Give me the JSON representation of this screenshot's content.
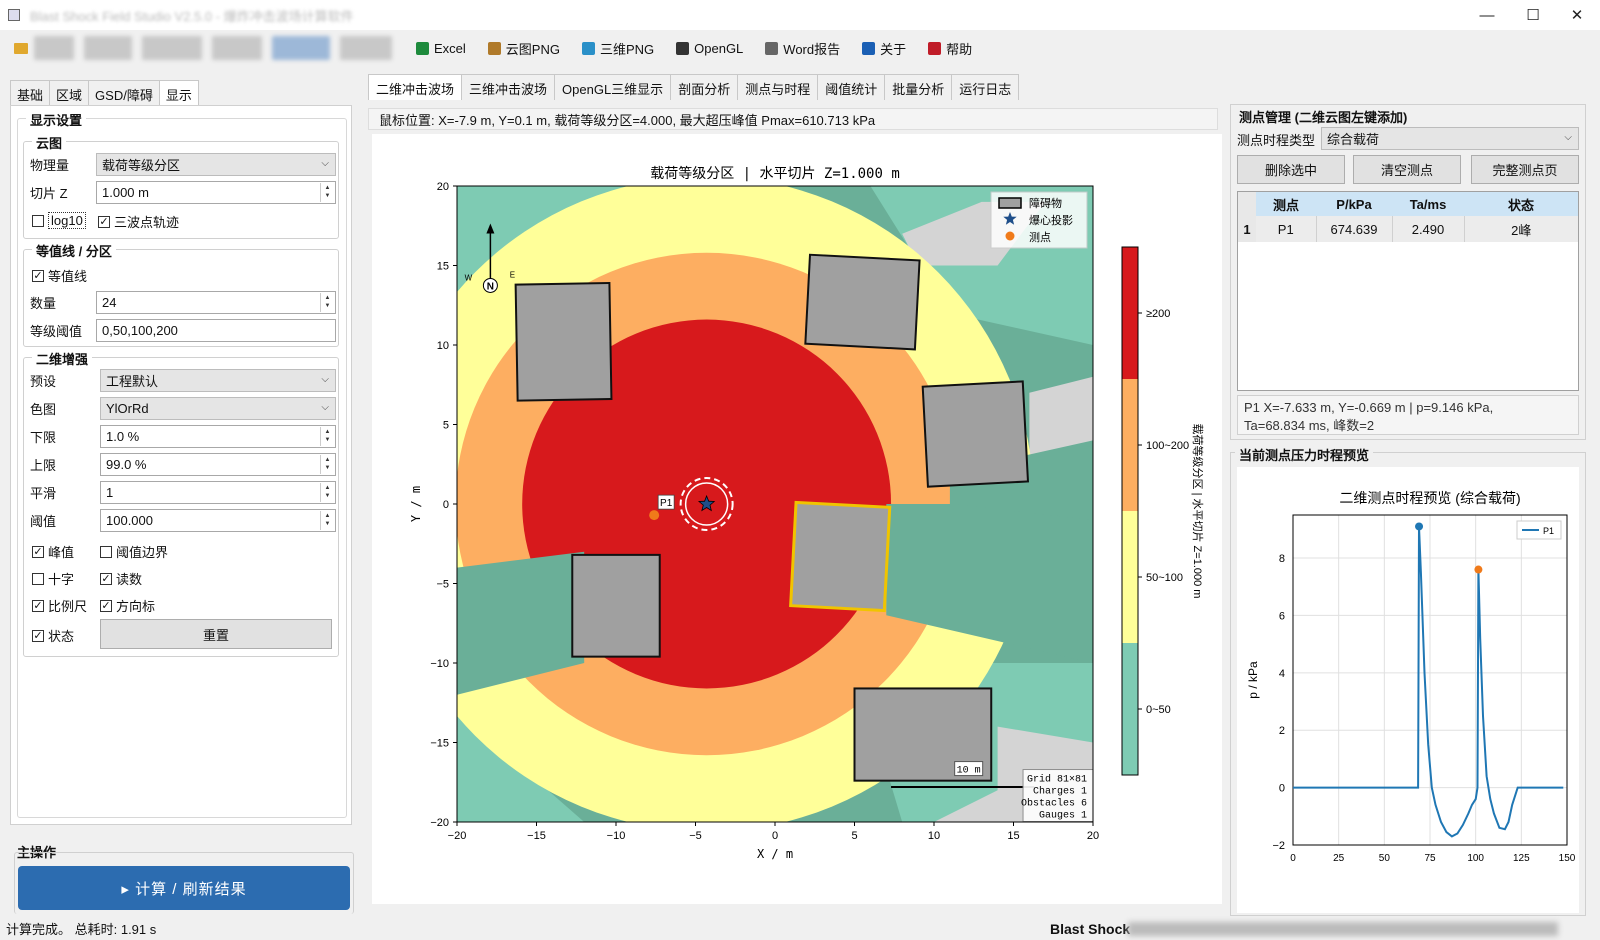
{
  "window": {
    "title": "Blast Shock Field Studio V2.5.0 - 爆炸冲击波场计算软件",
    "minimize": "—",
    "maximize": "☐",
    "close": "✕"
  },
  "toolbar": {
    "items": [
      {
        "label": "Excel",
        "icon": "excel-icon",
        "color": "#1d8a3c"
      },
      {
        "label": "云图PNG",
        "icon": "image-icon",
        "color": "#b07a2a"
      },
      {
        "label": "三维PNG",
        "icon": "globe-icon",
        "color": "#2a90c8"
      },
      {
        "label": "OpenGL",
        "icon": "monitor-icon",
        "color": "#333333"
      },
      {
        "label": "Word报告",
        "icon": "document-icon",
        "color": "#666666"
      },
      {
        "label": "关于",
        "icon": "info-icon",
        "color": "#1a5fb4"
      },
      {
        "label": "帮助",
        "icon": "help-icon",
        "color": "#c01c28"
      }
    ]
  },
  "left_tabs": [
    "基础",
    "区域",
    "GSD/障碍",
    "显示"
  ],
  "display": {
    "title": "显示设置",
    "cloud": {
      "title": "云图",
      "quantity_label": "物理量",
      "quantity_value": "载荷等级分区",
      "slice_label": "切片 Z",
      "slice_value": "1.000 m",
      "log10_label": "log10",
      "log10_checked": false,
      "trace_label": "三波点轨迹",
      "trace_checked": true
    },
    "contour": {
      "title": "等值线 / 分区",
      "enable_label": "等值线",
      "enable_checked": true,
      "count_label": "数量",
      "count_value": "24",
      "levels_label": "等级阈值",
      "levels_value": "0,50,100,200"
    },
    "enhance": {
      "title": "二维增强",
      "preset_label": "预设",
      "preset_value": "工程默认",
      "cmap_label": "色图",
      "cmap_value": "YlOrRd",
      "lower_label": "下限",
      "lower_value": "1.0 %",
      "upper_label": "上限",
      "upper_value": "99.0 %",
      "smooth_label": "平滑",
      "smooth_value": "1",
      "threshold_label": "阈值",
      "threshold_value": "100.000",
      "checks": [
        {
          "label": "峰值",
          "checked": true
        },
        {
          "label": "阈值边界",
          "checked": false
        },
        {
          "label": "十字",
          "checked": false
        },
        {
          "label": "读数",
          "checked": true
        },
        {
          "label": "比例尺",
          "checked": true
        },
        {
          "label": "方向标",
          "checked": true
        },
        {
          "label": "状态",
          "checked": true
        }
      ],
      "reset_label": "重置"
    }
  },
  "main_op": {
    "title": "主操作",
    "compute_label": "▸  计算 / 刷新结果"
  },
  "status": {
    "left": "计算完成。 总耗时: 1.91 s",
    "right": "Blast Shock"
  },
  "center_tabs": [
    "二维冲击波场",
    "三维冲击波场",
    "OpenGL三维显示",
    "剖面分析",
    "测点与时程",
    "阈值统计",
    "批量分析",
    "运行日志"
  ],
  "coord_text": "鼠标位置: X=-7.9 m, Y=0.1 m, 载荷等级分区=4.000, 最大超压峰值 Pmax=610.713 kPa",
  "chart_data": [
    {
      "type": "heatmap",
      "title": "载荷等级分区   |   水平切片 Z=1.000 m",
      "xlabel": "X / m",
      "ylabel": "Y / m",
      "xlim": [
        -20,
        20
      ],
      "ylim": [
        -20,
        20
      ],
      "xticks": [
        -20,
        -15,
        -10,
        -5,
        0,
        5,
        10,
        15,
        20
      ],
      "yticks": [
        20,
        15,
        10,
        5,
        0,
        -5,
        -10,
        -15,
        -20
      ],
      "colorbar": {
        "labels": [
          "≥200",
          "100~200",
          "50~100",
          "0~50"
        ],
        "colors": [
          "#d7191c",
          "#fdae61",
          "#ffff99",
          "#7ecbb3"
        ],
        "side_label": "载荷等级分区  |  水平切片 Z=1.000 m"
      },
      "legend": [
        {
          "label": "障碍物",
          "marker": "rect"
        },
        {
          "label": "爆心投影",
          "marker": "star"
        },
        {
          "label": "测点",
          "marker": "circle"
        }
      ],
      "charge": {
        "x": -4.3,
        "y": 0.0
      },
      "gauge": {
        "name": "P1",
        "x": -7.6,
        "y": -0.7
      },
      "obstacles": [
        {
          "cx": -13.3,
          "cy": 10.2,
          "w": 5.9,
          "h": 7.3,
          "rot": -1
        },
        {
          "cx": 5.5,
          "cy": 12.7,
          "w": 6.9,
          "h": 5.6,
          "rot": 3
        },
        {
          "cx": 12.6,
          "cy": 4.4,
          "w": 6.3,
          "h": 6.3,
          "rot": -3
        },
        {
          "cx": 4.1,
          "cy": -3.3,
          "w": 5.9,
          "h": 6.5,
          "rot": 3,
          "highlight": true
        },
        {
          "cx": -10.0,
          "cy": -6.4,
          "w": 5.5,
          "h": 6.4,
          "rot": 0
        },
        {
          "cx": 9.3,
          "cy": -14.5,
          "w": 8.6,
          "h": 5.8,
          "rot": 0
        }
      ],
      "info_box": [
        "Grid 81×81",
        "Charges 1",
        "Obstacles 6",
        "Gauges 1"
      ],
      "scale_bar_label": "10 m",
      "north_label": "N",
      "west_label": "W",
      "east_label": "E",
      "zone_radii_m": {
        "red": 11.6,
        "orange": 15.8,
        "yellow": 20.6
      }
    },
    {
      "type": "line",
      "title": "二维测点时程预览 (综合载荷)",
      "xlabel": "",
      "ylabel": "p / kPa",
      "xlim": [
        0,
        150
      ],
      "ylim": [
        -2,
        9.5
      ],
      "xticks": [
        0,
        25,
        50,
        75,
        100,
        125,
        150
      ],
      "yticks": [
        8,
        6,
        4,
        2,
        0,
        -2
      ],
      "series": [
        {
          "name": "P1",
          "x": [
            0,
            25,
            50,
            68.5,
            69,
            70,
            72,
            74,
            76,
            78,
            81,
            84,
            87,
            90,
            93,
            96,
            98,
            100,
            101,
            101.5,
            102.5,
            104,
            106,
            108,
            110,
            113,
            116,
            118,
            120,
            123,
            125,
            148
          ],
          "y": [
            0,
            0,
            0,
            0,
            9.1,
            7.5,
            4.0,
            1.5,
            0,
            -0.6,
            -1.2,
            -1.55,
            -1.7,
            -1.6,
            -1.3,
            -0.9,
            -0.6,
            -0.4,
            0,
            7.6,
            5.2,
            2.5,
            0.4,
            -0.4,
            -0.9,
            -1.4,
            -1.45,
            -1.2,
            -0.6,
            0,
            0,
            0
          ]
        }
      ],
      "peaks": [
        {
          "x": 69,
          "y": 9.1
        },
        {
          "x": 101.5,
          "y": 7.6
        }
      ]
    }
  ],
  "gauge_panel": {
    "title": "测点管理 (二维云图左键添加)",
    "type_label": "测点时程类型",
    "type_value": "综合载荷",
    "buttons": [
      "删除选中",
      "清空测点",
      "完整测点页"
    ],
    "columns": [
      "测点",
      "P/kPa",
      "Ta/ms",
      "状态"
    ],
    "rows": [
      {
        "index": "1",
        "cells": [
          "P1",
          "674.639",
          "2.490",
          "2峰"
        ]
      }
    ],
    "info_line1": "P1  X=-7.633 m, Y=-0.669 m  |  p=9.146 kPa,",
    "info_line2": "Ta=68.834 ms, 峰数=2"
  },
  "preview_panel": {
    "title": "当前测点压力时程预览"
  }
}
